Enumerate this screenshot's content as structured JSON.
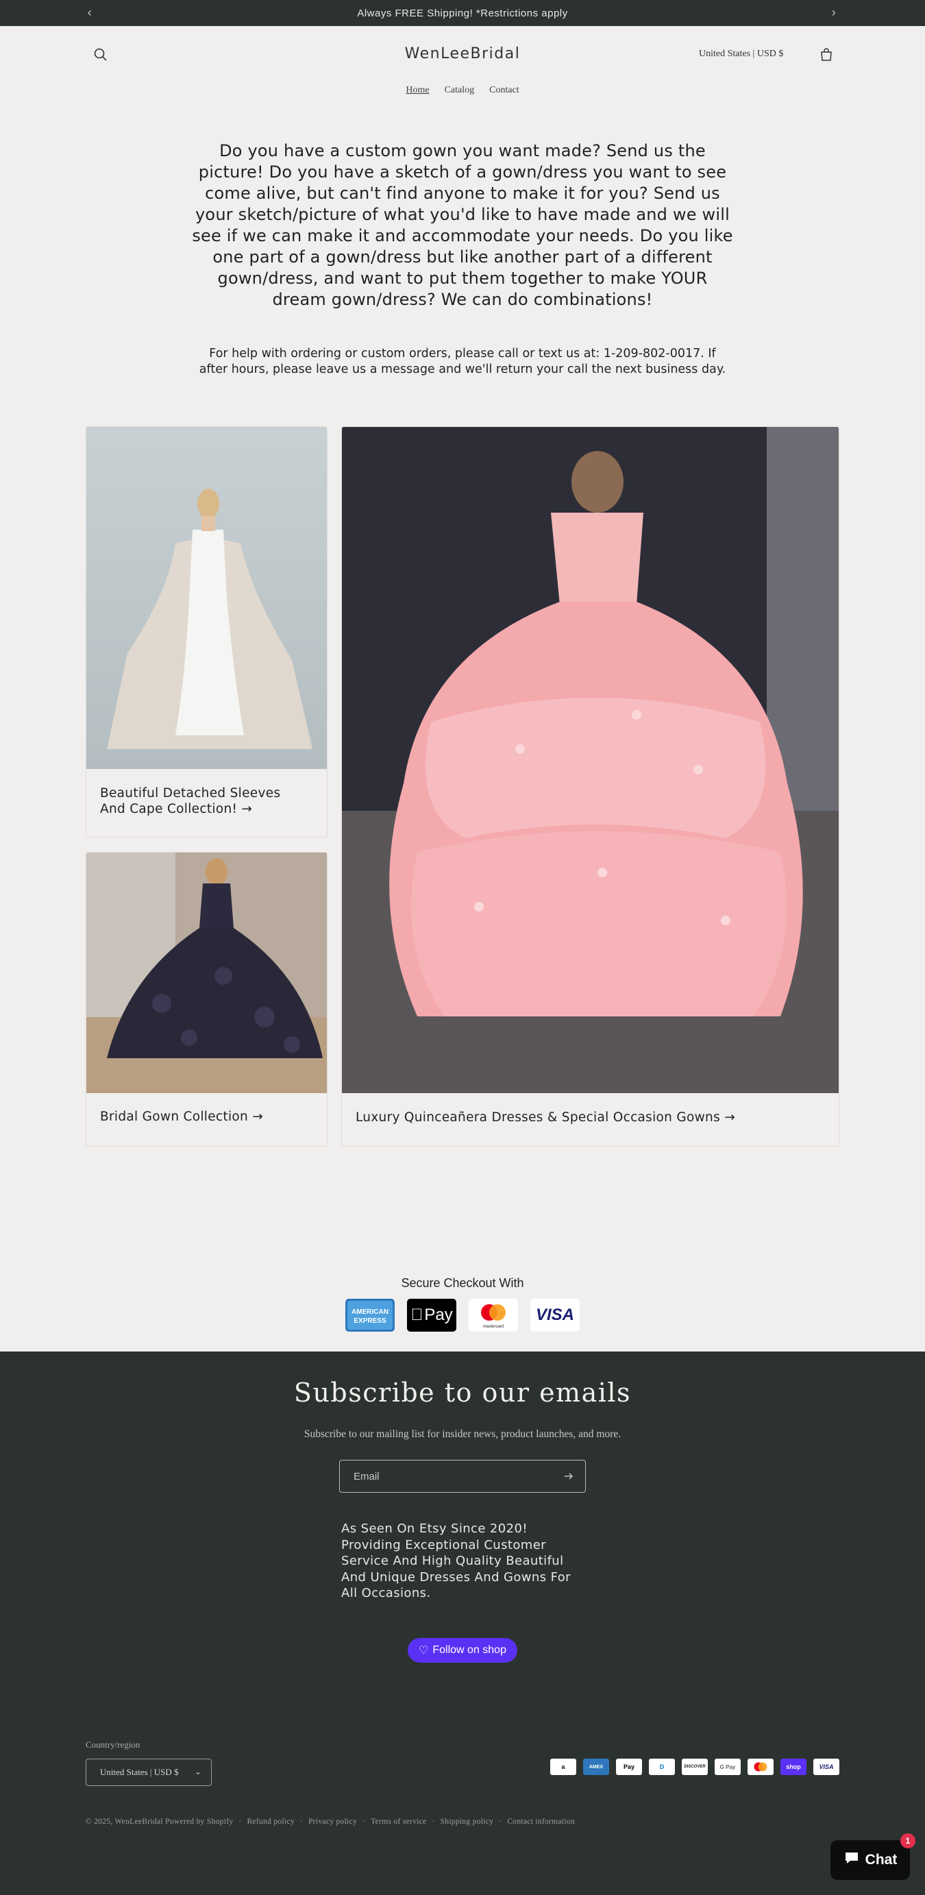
{
  "announcement": {
    "text": "Always FREE Shipping! *Restrictions apply"
  },
  "header": {
    "logo": "WenLeeBridal",
    "country_selector": "United States | USD $",
    "nav": [
      "Home",
      "Catalog",
      "Contact"
    ]
  },
  "intro": {
    "headline": "Do you have a custom gown you want made? Send us the picture! Do you have a sketch of a gown/dress you want to see come alive, but can't find anyone to make it for you? Send us your sketch/picture of what you'd like to have made and we will see if we can make it and accommodate your needs. Do you like one part of a gown/dress but like another part of a different gown/dress, and want to put them together to make YOUR dream gown/dress? We can do combinations!",
    "help": "For help with ordering or custom orders, please call or text us at: 1-209-802-0017. If after hours, please leave us a message and we'll return your call the next business day."
  },
  "collections": [
    {
      "label": "Beautiful Detached Sleeves And Cape Collection! →"
    },
    {
      "label": "Bridal Gown Collection →"
    },
    {
      "label": "Luxury Quinceañera Dresses & Special Occasion Gowns →"
    }
  ],
  "secure_checkout": {
    "title": "Secure Checkout With",
    "methods": [
      {
        "name": "american-express",
        "line1": "AMERICAN",
        "line2": "EXPRESS",
        "color": "#2e77bc"
      },
      {
        "name": "apple-pay",
        "label": "Pay",
        "color": "#000000"
      },
      {
        "name": "mastercard",
        "label": "mastercard",
        "color": "#eb001b"
      },
      {
        "name": "visa",
        "label": "VISA",
        "color": "#1a1f71"
      }
    ]
  },
  "footer": {
    "subscribe_title": "Subscribe to our emails",
    "subscribe_text": "Subscribe to our mailing list for insider news, product launches, and more.",
    "email_placeholder": "Email",
    "about": "As Seen On Etsy Since 2020! Providing Exceptional Customer Service And High Quality Beautiful And Unique Dresses And Gowns For All Occasions.",
    "follow_label": "Follow on shop",
    "country_label": "Country/region",
    "country_value": "United States | USD $",
    "payment_icons": [
      {
        "name": "amazon",
        "label": "a"
      },
      {
        "name": "american-express",
        "label": "AMEX"
      },
      {
        "name": "apple-pay",
        "label": "Pay"
      },
      {
        "name": "diners-club",
        "label": "D"
      },
      {
        "name": "discover",
        "label": "DISCOVER"
      },
      {
        "name": "google-pay",
        "label": "G Pay"
      },
      {
        "name": "mastercard",
        "label": ""
      },
      {
        "name": "shop-pay",
        "label": "shop"
      },
      {
        "name": "visa",
        "label": "VISA"
      }
    ],
    "copyright": "© 2025, WenLeeBridal Powered by Shopify",
    "policies": [
      "Refund policy",
      "Privacy policy",
      "Terms of service",
      "Shipping policy",
      "Contact information"
    ]
  },
  "chat": {
    "label": "Chat",
    "badge": "1"
  }
}
